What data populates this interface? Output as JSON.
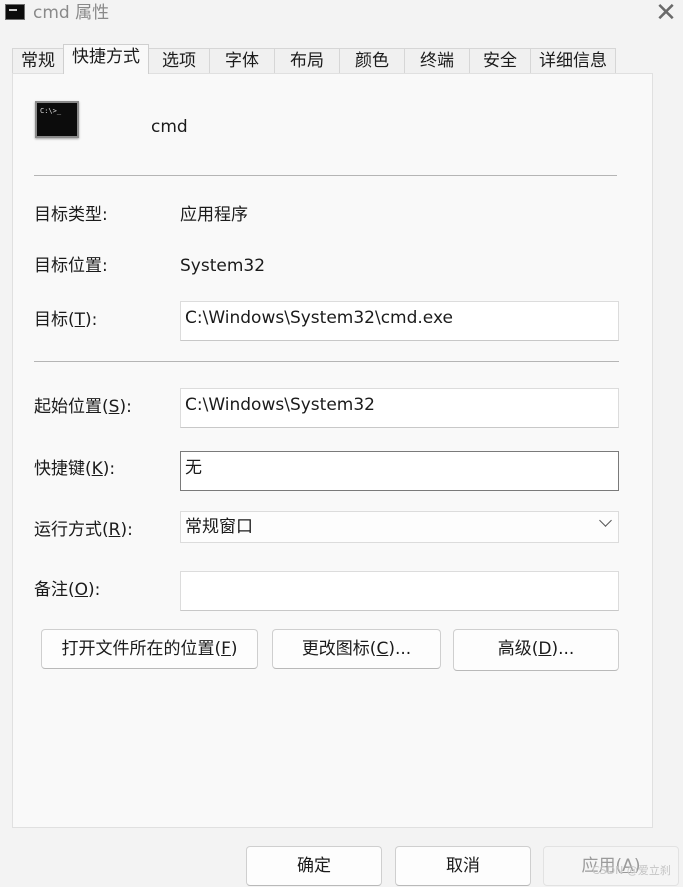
{
  "window": {
    "title": "cmd 属性"
  },
  "tabs": [
    {
      "label": "常规"
    },
    {
      "label": "快捷方式"
    },
    {
      "label": "选项"
    },
    {
      "label": "字体"
    },
    {
      "label": "布局"
    },
    {
      "label": "颜色"
    },
    {
      "label": "终端"
    },
    {
      "label": "安全"
    },
    {
      "label": "详细信息"
    }
  ],
  "active_tab": "快捷方式",
  "header": {
    "program_name": "cmd",
    "icon_text": "C:\\>_"
  },
  "info": {
    "target_type_label": "目标类型:",
    "target_type_value": "应用程序",
    "target_location_label": "目标位置:",
    "target_location_value": "System32"
  },
  "target": {
    "label_pre": "目标(",
    "key": "T",
    "label_post": "):",
    "value": "C:\\Windows\\System32\\cmd.exe"
  },
  "start_in": {
    "label_pre": "起始位置(",
    "key": "S",
    "label_post": "):",
    "value": "C:\\Windows\\System32"
  },
  "shortcut_key": {
    "label_pre": "快捷键(",
    "key": "K",
    "label_post": "):",
    "value": "无"
  },
  "run": {
    "label_pre": "运行方式(",
    "key": "R",
    "label_post": "):",
    "value": "常规窗口"
  },
  "comment": {
    "label_pre": "备注(",
    "key": "O",
    "label_post": "):",
    "value": ""
  },
  "buttons": {
    "open_location": {
      "pre": "打开文件所在的位置(",
      "key": "F",
      "post": ")"
    },
    "change_icon": {
      "pre": "更改图标(",
      "key": "C",
      "post": ")..."
    },
    "advanced": {
      "pre": "高级(",
      "key": "D",
      "post": ")..."
    }
  },
  "footer": {
    "ok": "确定",
    "cancel": "取消",
    "apply": {
      "pre": "应用(",
      "key": "A",
      "post": ")"
    }
  },
  "watermark": "CSDN @爱立刹"
}
